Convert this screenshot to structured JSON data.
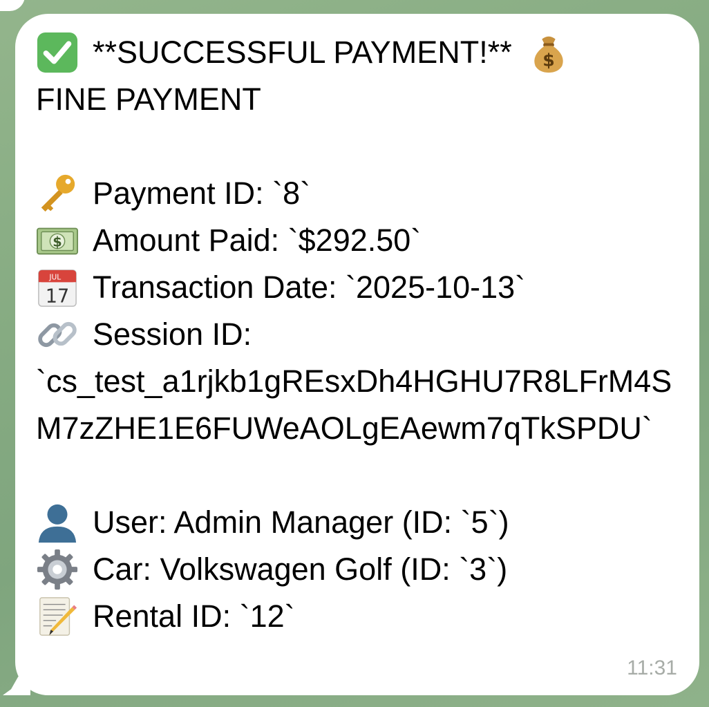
{
  "message": {
    "title": "**SUCCESSFUL PAYMENT!**",
    "subtitle": "FINE PAYMENT",
    "payment_id": "Payment ID: `8`",
    "amount_paid": "Amount Paid: `$292.50`",
    "transaction_date": "Transaction Date: `2025-10-13`",
    "session_id_label": "Session ID:",
    "session_id_value": "`cs_test_a1rjkb1gREsxDh4HGHU7R8LFrM4SM7zZHE1E6FUWeAOLgEAewm7qTkSPDU`",
    "user": "User: Admin Manager (ID: `5`)",
    "car": "Car: Volkswagen Golf (ID: `3`)",
    "rental_id": "Rental ID: `12`",
    "calendar_month": "JUL",
    "calendar_day": "17",
    "time": "11:31"
  },
  "icons": [
    "check-mark-icon",
    "money-bag-icon",
    "key-icon",
    "banknote-icon",
    "calendar-icon",
    "link-icon",
    "user-silhouette-icon",
    "gear-icon",
    "memo-icon"
  ],
  "colors": {
    "background": "#86ab82",
    "bubble": "#ffffff",
    "text": "#000000",
    "timestamp": "#a7aca7",
    "check_green": "#5cb85c"
  }
}
